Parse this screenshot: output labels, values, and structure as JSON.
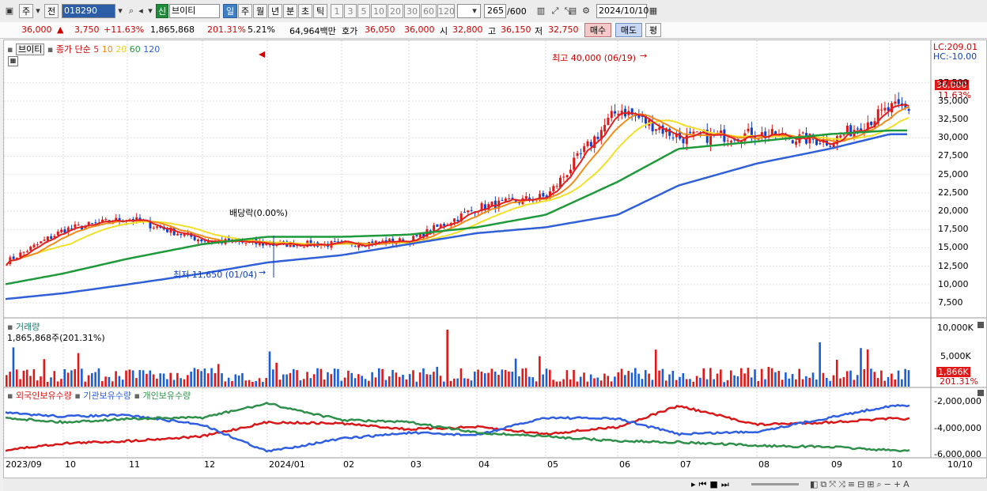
{
  "toolbar": {
    "market_labels": [
      "주",
      "전"
    ],
    "code": "018290",
    "name_prefix": "신",
    "stock_name": "브이티",
    "period_tabs": [
      "일",
      "주",
      "월",
      "년",
      "분",
      "초",
      "틱"
    ],
    "interval_options": [
      "1",
      "3",
      "5",
      "10",
      "20",
      "30",
      "60",
      "120"
    ],
    "count": "265",
    "count_max": "/600",
    "date": "2024/10/10"
  },
  "quote_bar": {
    "price": "36,000",
    "change": "3,750",
    "change_pct": "+11.63%",
    "volume": "1,865,868",
    "volume_ratio": "201.31%",
    "turnover": "5.21%",
    "amount": "64,964백만",
    "bid_label": "호가",
    "bid_ask": "36,050",
    "bid_ask2": "36,000",
    "open_label": "시",
    "open": "32,800",
    "high_label": "고",
    "high": "36,150",
    "low_label": "저",
    "low": "32,750",
    "buy_btn": "매수",
    "sell_btn": "매도",
    "eval_btn": "평"
  },
  "price_panel": {
    "stock_label": "브이티",
    "ma_label": "종가 단순",
    "ma_periods": [
      "5",
      "10",
      "20",
      "60",
      "120"
    ],
    "max_note": "최고 40,000 (06/19)",
    "min_note": "최저 11,650 (01/04)",
    "dividend_note": "배당락(0.00%)",
    "lc": "LC:209.01",
    "hc": "HC:-10.00",
    "current_tag": "36,000",
    "current_pct": "11.63%",
    "axis_ticks": [
      "37,500",
      "35,000",
      "32,500",
      "30,000",
      "27,500",
      "25,000",
      "22,500",
      "20,000",
      "17,500",
      "15,000",
      "12,500",
      "10,000",
      "7,500"
    ]
  },
  "volume_panel": {
    "title": "거래량",
    "value_label": "1,865,868주(201.31%)",
    "axis_ticks": [
      "10,000K",
      "5,000K"
    ],
    "current_tag": "1,866K",
    "current_pct": "201.31%"
  },
  "holdings_panel": {
    "legend": [
      "외국인보유수량",
      "기관보유수량",
      "개인보유수량"
    ],
    "axis_ticks": [
      "-2,000,000",
      "-4,000,000",
      "-6,000,000"
    ]
  },
  "x_axis": [
    "2023/09",
    "10",
    "11",
    "12",
    "2024/01",
    "02",
    "03",
    "04",
    "05",
    "06",
    "07",
    "08",
    "09",
    "10",
    "10/10"
  ],
  "colors": {
    "up": "#d10000",
    "down": "#1040c0",
    "ma5": "#e02020",
    "ma10": "#f08c1a",
    "ma20": "#f2e028",
    "ma60": "#1f9a3a",
    "ma120": "#3060d8",
    "foreign": "#d81818",
    "institution": "#2f5ee0",
    "individual": "#2e8f4a"
  },
  "chart_data": {
    "type": "line",
    "x": [
      "2023/09",
      "10",
      "11",
      "12",
      "2024/01",
      "02",
      "03",
      "04",
      "05",
      "06",
      "07",
      "08",
      "09",
      "10"
    ],
    "series": [
      {
        "values": [
          13000,
          17500,
          19000,
          16000,
          15500,
          15500,
          16000,
          20500,
          22000,
          34000,
          30000,
          30500,
          29500,
          34000
        ]
      },
      {
        "values": [
          10000,
          11500,
          13500,
          15500,
          16500,
          16500,
          16800,
          17800,
          19500,
          24000,
          28500,
          29500,
          30500,
          31000
        ]
      },
      {
        "values": [
          8000,
          8800,
          10000,
          11500,
          13000,
          14000,
          15500,
          17000,
          17800,
          19500,
          23500,
          26500,
          28500,
          30500
        ]
      }
    ],
    "ylim": [
      7500,
      40000
    ]
  }
}
